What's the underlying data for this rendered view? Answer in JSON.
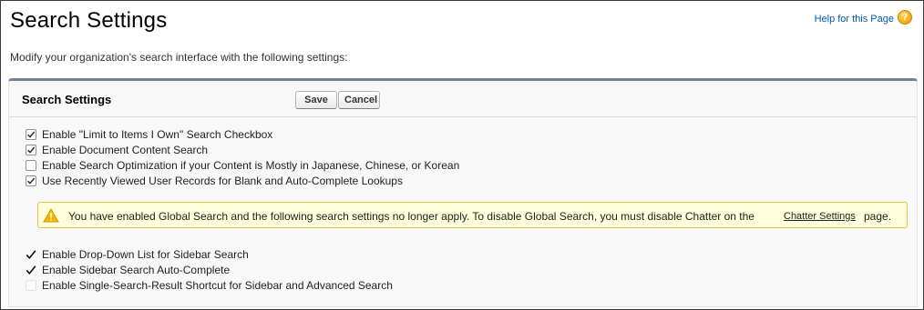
{
  "page": {
    "title": "Search Settings",
    "help_label": "Help for this Page",
    "help_icon": "question-circle-icon",
    "description": "Modify your organization's search interface with the following settings:"
  },
  "panel": {
    "title": "Search Settings",
    "save_label": "Save",
    "cancel_label": "Cancel"
  },
  "options": [
    {
      "label": "Enable \"Limit to Items I Own\" Search Checkbox",
      "checked": true
    },
    {
      "label": "Enable Document Content Search",
      "checked": true
    },
    {
      "label": "Enable Search Optimization if your Content is Mostly in Japanese, Chinese, or Korean",
      "checked": false
    },
    {
      "label": "Use Recently Viewed User Records for Blank and Auto-Complete Lookups",
      "checked": true
    }
  ],
  "warning": {
    "icon": "warning-triangle-icon",
    "text": "You have enabled Global Search and the following search settings no longer apply. To disable Global Search, you must disable Chatter on the",
    "link_label": "Chatter Settings",
    "tail": "page."
  },
  "legacy_options": [
    {
      "label": "Enable Drop-Down List for Sidebar Search",
      "checked": true
    },
    {
      "label": "Enable Sidebar Search Auto-Complete",
      "checked": true
    },
    {
      "label": "Enable Single-Search-Result Shortcut for Sidebar and Advanced Search",
      "checked": false
    }
  ],
  "colors": {
    "link": "#015ba7",
    "panel_top_border": "#747e96",
    "warning_bg": "#ffffdc",
    "warning_border": "#e7c54a"
  }
}
